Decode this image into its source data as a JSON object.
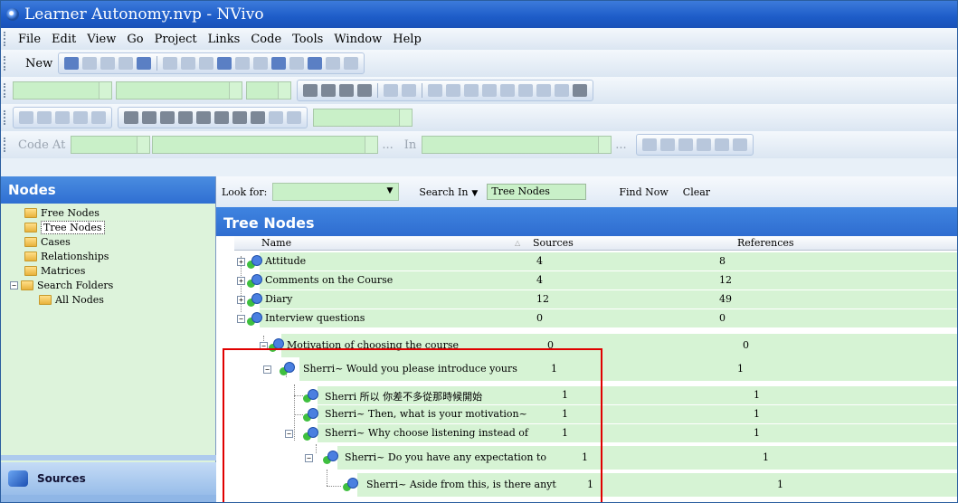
{
  "window": {
    "title": "Learner Autonomy.nvp - NVivo"
  },
  "menu": {
    "items": [
      "File",
      "Edit",
      "View",
      "Go",
      "Project",
      "Links",
      "Code",
      "Tools",
      "Window",
      "Help"
    ]
  },
  "toolbar": {
    "new_label": "New",
    "code_at_label": "Code At",
    "in_label": "In",
    "ellipsis": "..."
  },
  "nav": {
    "title": "Nodes",
    "items": [
      {
        "label": "Free Nodes"
      },
      {
        "label": "Tree Nodes",
        "selected": true
      },
      {
        "label": "Cases"
      },
      {
        "label": "Relationships"
      },
      {
        "label": "Matrices"
      },
      {
        "label": "Search Folders"
      },
      {
        "label": "All Nodes"
      }
    ],
    "sources_label": "Sources"
  },
  "find": {
    "look_for_label": "Look for:",
    "search_in_label": "Search In",
    "search_in_value": "Tree Nodes",
    "find_now_label": "Find Now",
    "clear_label": "Clear"
  },
  "content": {
    "title": "Tree Nodes",
    "columns": {
      "name": "Name",
      "sources": "Sources",
      "references": "References"
    },
    "rows": [
      {
        "name": "Attitude",
        "sources": "4",
        "references": "8"
      },
      {
        "name": "Comments on the Course",
        "sources": "4",
        "references": "12"
      },
      {
        "name": "Diary",
        "sources": "12",
        "references": "49"
      },
      {
        "name": "Interview questions",
        "sources": "0",
        "references": "0"
      },
      {
        "name": "Motivation of choosing the course",
        "sources": "0",
        "references": "0"
      },
      {
        "name": "Sherri~ Would you please introduce yours",
        "sources": "1",
        "references": "1"
      },
      {
        "name": "Sherri 所以 你差不多從那時候開始",
        "sources": "1",
        "references": "1"
      },
      {
        "name": "Sherri~ Then, what is your motivation~",
        "sources": "1",
        "references": "1"
      },
      {
        "name": "Sherri~ Why choose listening instead of",
        "sources": "1",
        "references": "1"
      },
      {
        "name": "Sherri~ Do you have any expectation to",
        "sources": "1",
        "references": "1"
      },
      {
        "name": "Sherri~ Aside from this, is there anyt",
        "sources": "1",
        "references": "1"
      }
    ]
  },
  "colors": {
    "title_bar": "#1d5cc8",
    "panel_header": "#2f6dd0",
    "row_green": "#d6f3d4",
    "highlight_box": "#e00000"
  }
}
